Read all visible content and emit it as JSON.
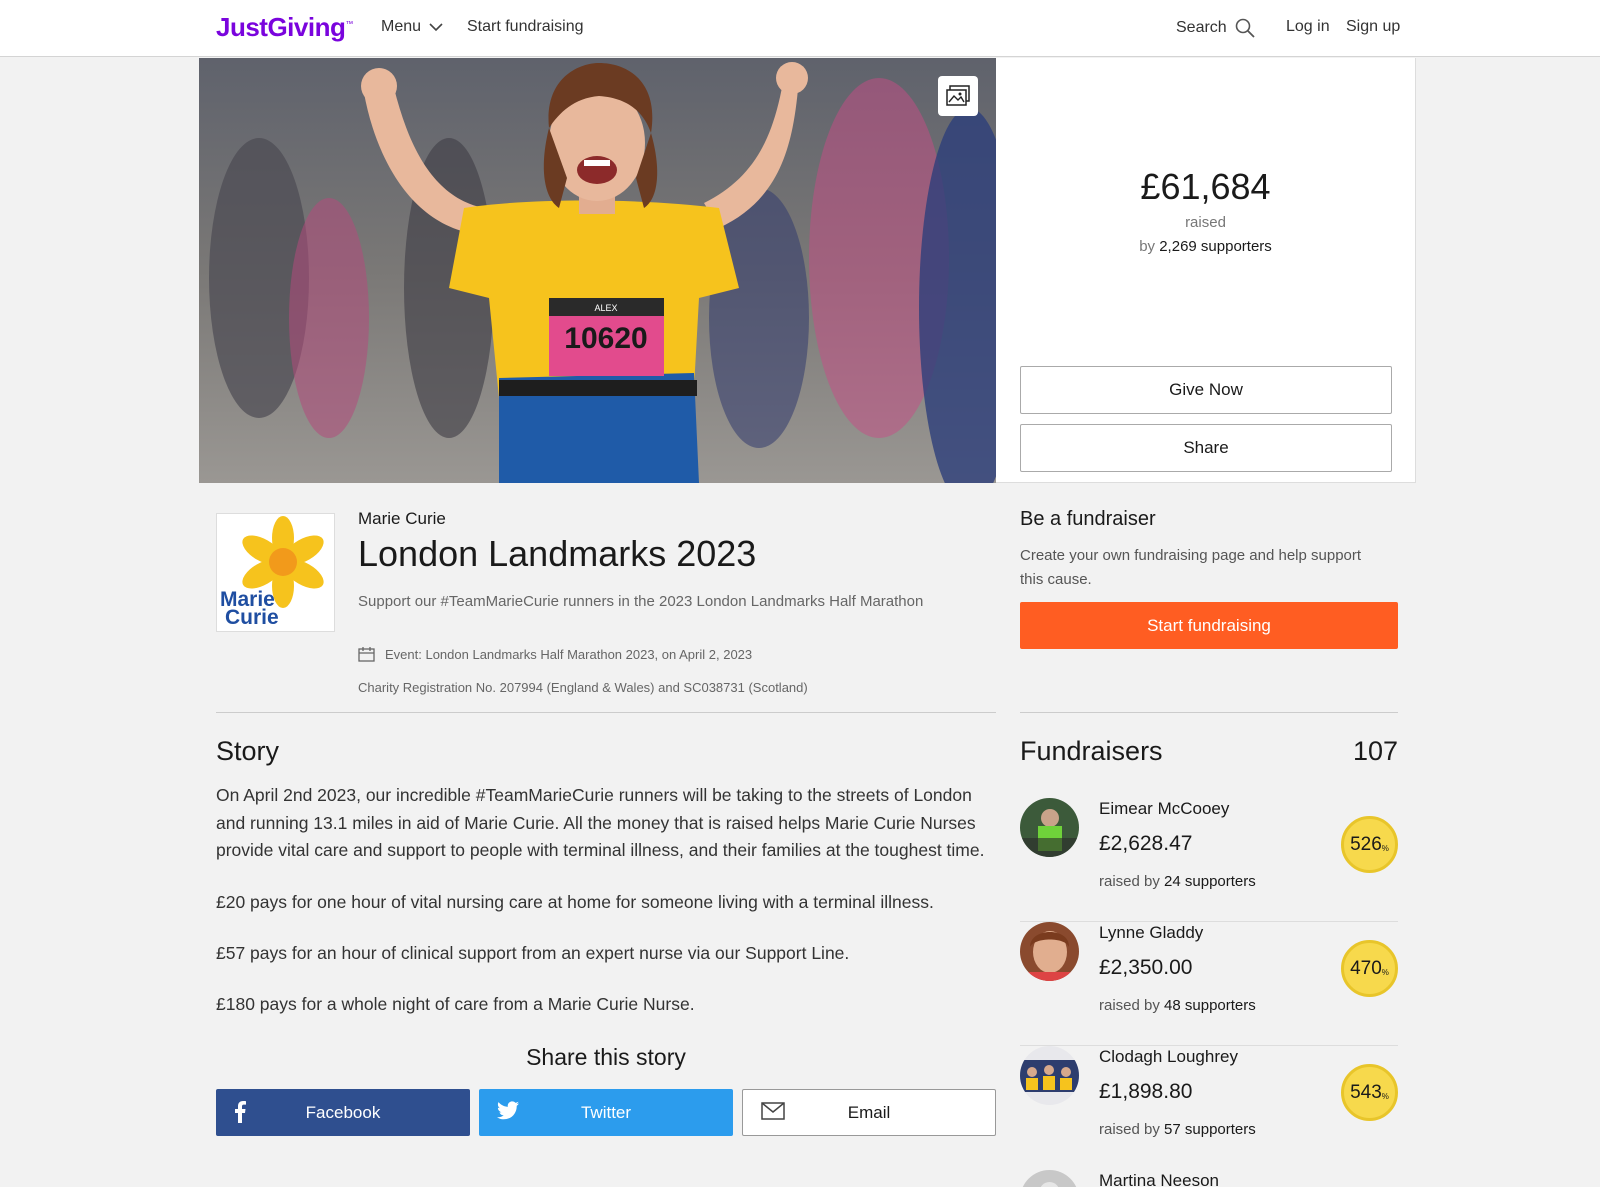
{
  "header": {
    "logo": "JustGiving",
    "logo_tm": "™",
    "menu_label": "Menu",
    "start_label": "Start fundraising",
    "search_label": "Search",
    "login_label": "Log in",
    "signup_label": "Sign up"
  },
  "hero": {
    "amount": "£61,684",
    "raised_label": "raised",
    "by_prefix": "by",
    "supporters": "2,269 supporters",
    "give_label": "Give Now",
    "share_label": "Share",
    "bib_name": "ALEX",
    "bib_number": "10620"
  },
  "charity": {
    "name": "Marie Curie",
    "logo_text_1": "Marie",
    "logo_text_2": "Curie",
    "title": "London Landmarks 2023",
    "subtitle": "Support our #TeamMarieCurie runners in the 2023 London Landmarks Half Marathon",
    "event": "Event: London Landmarks Half Marathon 2023, on April 2, 2023",
    "registration": "Charity Registration No. 207994 (England & Wales) and SC038731 (Scotland)"
  },
  "fundraiser_promo": {
    "title": "Be a fundraiser",
    "text": "Create your own fundraising page and help support this cause.",
    "button": "Start fundraising"
  },
  "story": {
    "title": "Story",
    "paragraphs": [
      "On April 2nd 2023, our incredible #TeamMarieCurie runners will be taking to the streets of London and running 13.1 miles in aid of Marie Curie. All the money that is raised helps Marie Curie Nurses provide vital care and support to people with terminal illness, and their families at the toughest time.",
      "£20 pays for one hour of vital nursing care at home for someone living with a terminal illness.",
      "£57 pays for an hour of clinical support from an expert nurse via our Support Line.",
      "£180 pays for a whole night of care from a Marie Curie Nurse."
    ],
    "share_title": "Share this story",
    "facebook": "Facebook",
    "twitter": "Twitter",
    "email": "Email"
  },
  "fundraisers": {
    "title": "Fundraisers",
    "count": "107",
    "raised_by": "raised by",
    "percent_symbol": "%",
    "items": [
      {
        "name": "Eimear McCooey",
        "amount": "£2,628.47",
        "supporters": "24 supporters",
        "percent": "526"
      },
      {
        "name": "Lynne Gladdy",
        "amount": "£2,350.00",
        "supporters": "48 supporters",
        "percent": "470"
      },
      {
        "name": "Clodagh Loughrey",
        "amount": "£1,898.80",
        "supporters": "57 supporters",
        "percent": "543"
      },
      {
        "name": "Martina Neeson"
      }
    ]
  },
  "colors": {
    "brand": "#7a04dd",
    "start_button": "#ff5d22",
    "facebook": "#2f4f8f",
    "twitter": "#2c9ced",
    "badge": "#f7d94c"
  }
}
